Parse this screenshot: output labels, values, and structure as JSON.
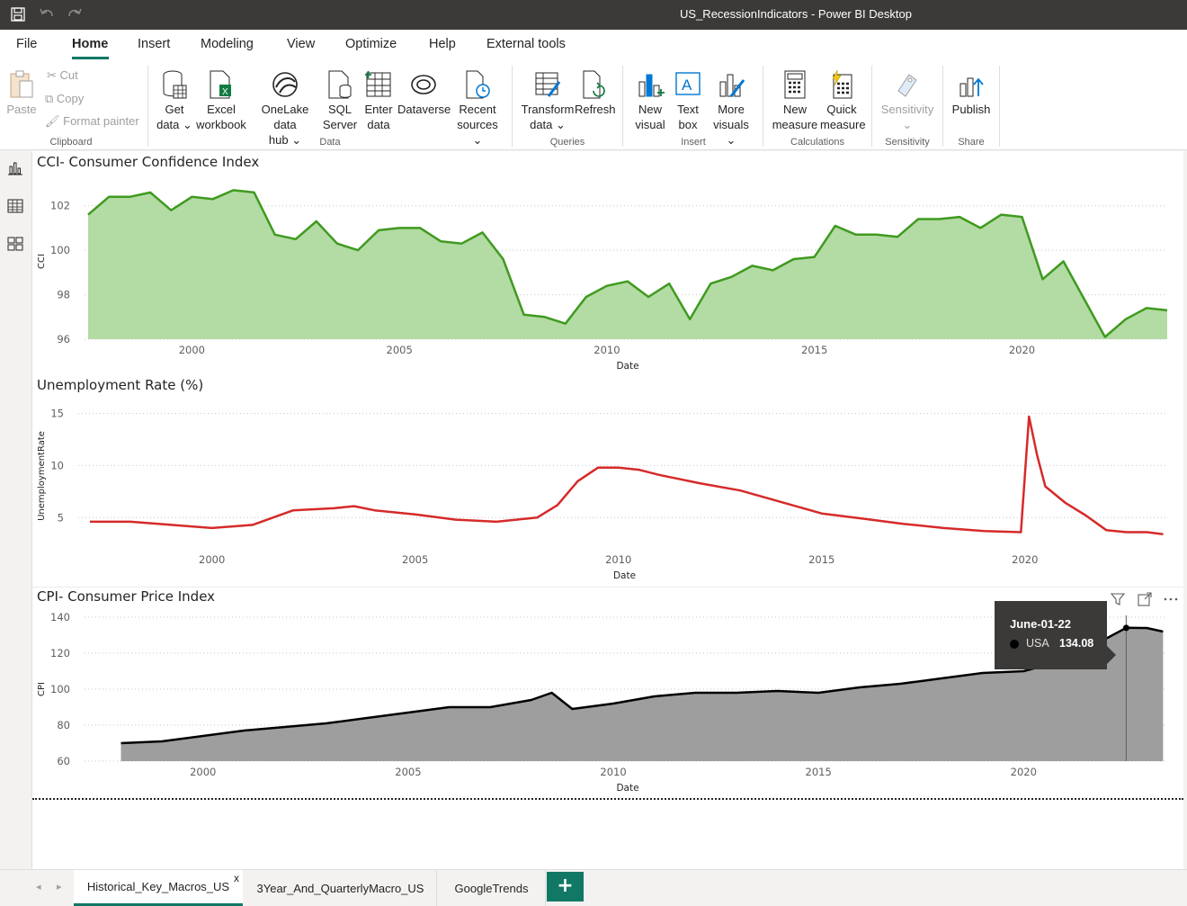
{
  "window": {
    "title": "US_RecessionIndicators - Power BI Desktop"
  },
  "menu": {
    "tabs": [
      "File",
      "Home",
      "Insert",
      "Modeling",
      "View",
      "Optimize",
      "Help",
      "External tools"
    ],
    "active": "Home"
  },
  "ribbon": {
    "clipboard": {
      "paste": "Paste",
      "cut": "Cut",
      "copy": "Copy",
      "format_painter": "Format painter",
      "group": "Clipboard"
    },
    "data": {
      "get_data": [
        "Get",
        "data ⌄"
      ],
      "excel": [
        "Excel",
        "workbook"
      ],
      "onelake": [
        "OneLake data",
        "hub ⌄"
      ],
      "sql": [
        "SQL",
        "Server"
      ],
      "enter": [
        "Enter",
        "data"
      ],
      "dataverse": "Dataverse",
      "recent": [
        "Recent",
        "sources ⌄"
      ],
      "group": "Data"
    },
    "queries": {
      "transform": [
        "Transform",
        "data ⌄"
      ],
      "refresh": "Refresh",
      "group": "Queries"
    },
    "insert": {
      "new_visual": [
        "New",
        "visual"
      ],
      "text_box": [
        "Text",
        "box"
      ],
      "more_visuals": [
        "More",
        "visuals ⌄"
      ],
      "group": "Insert"
    },
    "calculations": {
      "new_measure": [
        "New",
        "measure"
      ],
      "quick_measure": [
        "Quick",
        "measure"
      ],
      "group": "Calculations"
    },
    "sensitivity": {
      "label": "Sensitivity",
      "chevron": "⌄",
      "group": "Sensitivity"
    },
    "share": {
      "publish": "Publish",
      "group": "Share"
    }
  },
  "icons": {
    "save": "save-icon",
    "undo": "undo-icon",
    "redo": "redo-icon",
    "report_view": "bar-chart-icon",
    "table_view": "table-icon",
    "model_view": "model-icon",
    "filter": "filter-icon",
    "focus": "focus-mode-icon",
    "more": "more-options-icon"
  },
  "colors": {
    "cci": "#3f9a1f",
    "cci_fill": "#b3dba4",
    "unemp": "#d62a2a",
    "cpi": "#000000",
    "cpi_fill": "#9e9e9e",
    "accent": "#117865"
  },
  "visuals": {
    "cci": {
      "title": "CCI- Consumer Confidence Index",
      "ylabel": "CCI",
      "xlabel": "Date"
    },
    "unemp": {
      "title": "Unemployment Rate (%)",
      "ylabel": "UnemploymentRate",
      "xlabel": "Date"
    },
    "cpi": {
      "title": "CPI- Consumer Price Index",
      "ylabel": "CPI",
      "xlabel": "Date"
    }
  },
  "tooltip": {
    "date": "June-01-22",
    "series": "USA",
    "value": "134.08"
  },
  "pages": {
    "tabs": [
      "Historical_Key_Macros_US",
      "3Year_And_QuarterlyMacro_US",
      "GoogleTrends"
    ],
    "active": "Historical_Key_Macros_US",
    "close": "x",
    "add": "+"
  },
  "chart_data": [
    {
      "type": "area",
      "title": "CCI- Consumer Confidence Index",
      "xlabel": "Date",
      "ylabel": "CCI",
      "xlim": [
        1997.5,
        2023.5
      ],
      "ylim": [
        96,
        103
      ],
      "xticks": [
        2000,
        2005,
        2010,
        2015,
        2020
      ],
      "yticks": [
        96,
        98,
        100,
        102
      ],
      "grid": true,
      "x": [
        1997.5,
        1998,
        1998.5,
        1999,
        1999.5,
        2000,
        2000.5,
        2001,
        2001.5,
        2002,
        2002.5,
        2003,
        2003.5,
        2004,
        2004.5,
        2005,
        2005.5,
        2006,
        2006.5,
        2007,
        2007.5,
        2008,
        2008.5,
        2009,
        2009.5,
        2010,
        2010.5,
        2011,
        2011.5,
        2012,
        2012.5,
        2013,
        2013.5,
        2014,
        2014.5,
        2015,
        2015.5,
        2016,
        2016.5,
        2017,
        2017.5,
        2018,
        2018.5,
        2019,
        2019.5,
        2020,
        2020.5,
        2021,
        2021.5,
        2022,
        2022.5,
        2023,
        2023.5
      ],
      "values": [
        101.6,
        102.4,
        102.4,
        102.6,
        101.8,
        102.4,
        102.3,
        102.7,
        102.6,
        100.7,
        100.5,
        101.3,
        100.3,
        100.0,
        100.9,
        101.0,
        101.0,
        100.4,
        100.3,
        100.8,
        99.6,
        97.1,
        97.0,
        96.7,
        97.9,
        98.4,
        98.6,
        97.9,
        98.5,
        96.9,
        98.5,
        98.8,
        99.3,
        99.1,
        99.6,
        99.7,
        101.1,
        100.7,
        100.7,
        100.6,
        101.4,
        101.4,
        101.5,
        101.0,
        101.6,
        101.5,
        98.7,
        99.5,
        97.8,
        96.1,
        96.9,
        97.4,
        97.3
      ]
    },
    {
      "type": "line",
      "title": "Unemployment Rate (%)",
      "xlabel": "Date",
      "ylabel": "UnemploymentRate",
      "xlim": [
        1996.8,
        2023.5
      ],
      "ylim": [
        2,
        16
      ],
      "xticks": [
        2000,
        2005,
        2010,
        2015,
        2020
      ],
      "yticks": [
        5,
        10,
        15
      ],
      "grid": true,
      "x": [
        1997,
        1998,
        1999,
        2000,
        2001,
        2002,
        2003,
        2003.5,
        2004,
        2005,
        2006,
        2007,
        2008,
        2008.5,
        2009,
        2009.5,
        2010,
        2010.5,
        2011,
        2012,
        2013,
        2014,
        2015,
        2016,
        2017,
        2018,
        2019,
        2019.9,
        2020.1,
        2020.3,
        2020.5,
        2021,
        2021.5,
        2022,
        2022.5,
        2023,
        2023.4
      ],
      "values": [
        4.6,
        4.6,
        4.3,
        4.0,
        4.3,
        5.7,
        5.9,
        6.1,
        5.7,
        5.3,
        4.8,
        4.6,
        5.0,
        6.2,
        8.5,
        9.8,
        9.8,
        9.6,
        9.1,
        8.3,
        7.6,
        6.5,
        5.4,
        4.9,
        4.4,
        4.0,
        3.7,
        3.6,
        14.7,
        11.0,
        8.0,
        6.4,
        5.2,
        3.8,
        3.6,
        3.6,
        3.4
      ]
    },
    {
      "type": "area",
      "title": "CPI- Consumer Price Index",
      "xlabel": "Date",
      "ylabel": "CPI",
      "xlim": [
        1997.2,
        2023.5
      ],
      "ylim": [
        60,
        140
      ],
      "xticks": [
        2000,
        2005,
        2010,
        2015,
        2020
      ],
      "yticks": [
        60,
        80,
        100,
        120,
        140
      ],
      "grid": true,
      "x": [
        1998,
        1999,
        2000,
        2001,
        2002,
        2003,
        2004,
        2005,
        2006,
        2007,
        2008,
        2008.5,
        2009,
        2010,
        2011,
        2012,
        2013,
        2014,
        2015,
        2016,
        2017,
        2018,
        2019,
        2020,
        2021,
        2022,
        2022.5,
        2023,
        2023.4
      ],
      "values": [
        70,
        71,
        74,
        77,
        79,
        81,
        84,
        87,
        90,
        90,
        94,
        98,
        89,
        92,
        96,
        98,
        98,
        99,
        98,
        101,
        103,
        106,
        109,
        110,
        116,
        128,
        134.08,
        134,
        132
      ]
    }
  ]
}
